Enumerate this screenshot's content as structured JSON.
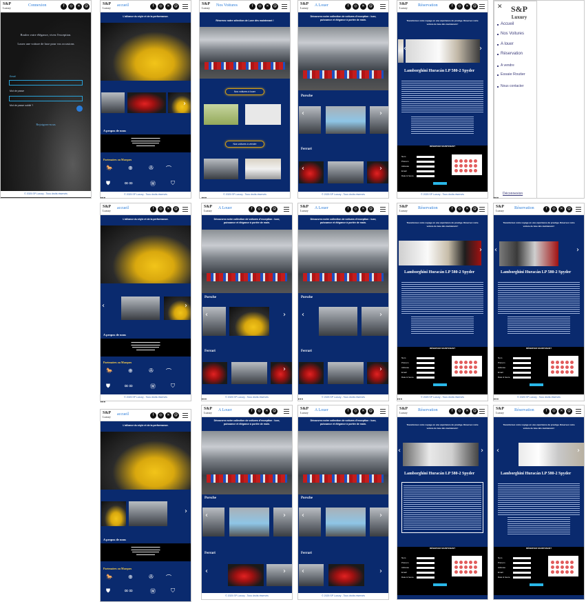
{
  "brand": {
    "logo": "S&P",
    "logo_sub": "Luxury"
  },
  "social_icons": [
    "facebook-icon",
    "instagram-icon",
    "x-icon",
    "threads-icon"
  ],
  "footer": "© 2025 SP Luxury - Tous droits réservés",
  "login": {
    "title": "Connexion",
    "tagline_1": "Roulez votre élégance, vivez l'exception.",
    "tagline_2": "Louez une voiture de luxe pour vos occasions",
    "email_label": "Email",
    "password_label": "Mot de passe",
    "forgot": "Mot de passe oublié ?",
    "register": "Rejoignez-nous"
  },
  "home": {
    "title": "accueil",
    "slogan": "L'alliance du style et de la performance.",
    "about_title": "A propos de nous",
    "partners_title": "Partenaires ou Marques"
  },
  "sale": {
    "title": "Nos Voitures",
    "intro": "Réservez notre sélection de Luxe dès maintenant !",
    "btn_rent": "Nos voitures à louer",
    "btn_sale": "Nos voitures à vendre"
  },
  "rent": {
    "title": "A Louer",
    "intro": "Découvrez notre collection de voitures d'exception : luxe, puissance et élégance à portée de main.",
    "porsche": "Porsche",
    "ferrari": "Ferrari"
  },
  "reservation": {
    "title": "Réservation",
    "intro": "Transformez votre voyage en une expérience de prestige. Réservez votre voiture de luxe dès maintenant !",
    "car": "Lamborghini Huracán LP 580-2 Spyder",
    "booking": "RÉSERVER MAINTENANT",
    "form_fields": [
      "Nom",
      "Prénom",
      "Adresse",
      "Email",
      "Date & heure"
    ]
  },
  "menu": {
    "items": [
      "Accueil",
      "Nos Voitures",
      "A louer",
      "Réservation",
      "A vendre",
      "Essaie Routier",
      "Nous contacter"
    ],
    "logout": "Déconnexion"
  }
}
